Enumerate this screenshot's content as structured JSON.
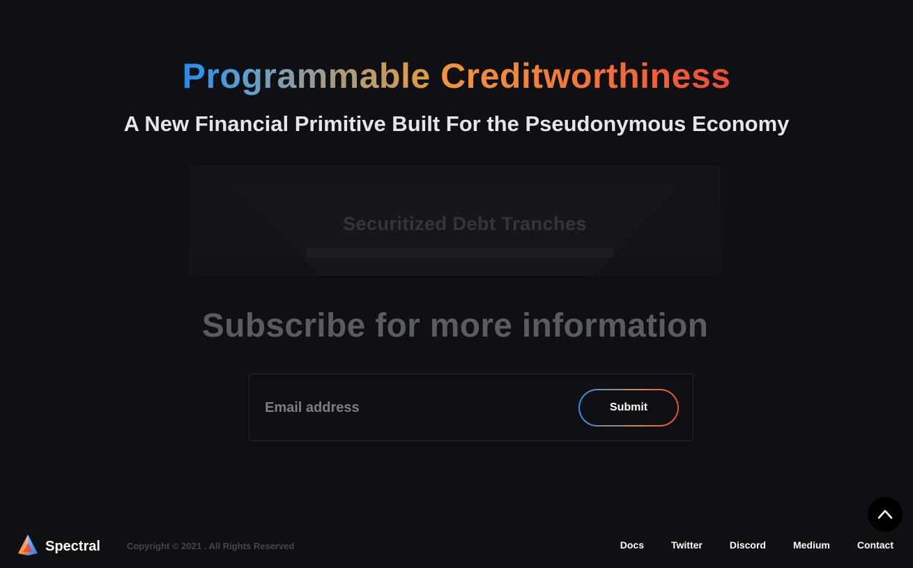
{
  "hero": {
    "headline_part1": "Programmable",
    "headline_part2": "Creditworthiness",
    "subheadline": "A New Financial Primitive Built For the Pseudonymous Economy"
  },
  "tranche_card": {
    "title": "Securitized Debt Tranches"
  },
  "subscribe": {
    "title": "Subscribe for more information",
    "email_placeholder": "Email address",
    "submit_label": "Submit"
  },
  "footer": {
    "brand": "Spectral",
    "copyright": "Copyright © 2021 . All Rights Reserved",
    "links": [
      "Docs",
      "Twitter",
      "Discord",
      "Medium",
      "Contact"
    ]
  },
  "icons": {
    "scroll_top": "chevron-up-icon",
    "logo": "prism-logo-icon"
  },
  "colors": {
    "background": "#0f1014",
    "gradient_blue": "#1d8ef5",
    "gradient_orange": "#f3943a",
    "gradient_red": "#ee4b3a"
  }
}
